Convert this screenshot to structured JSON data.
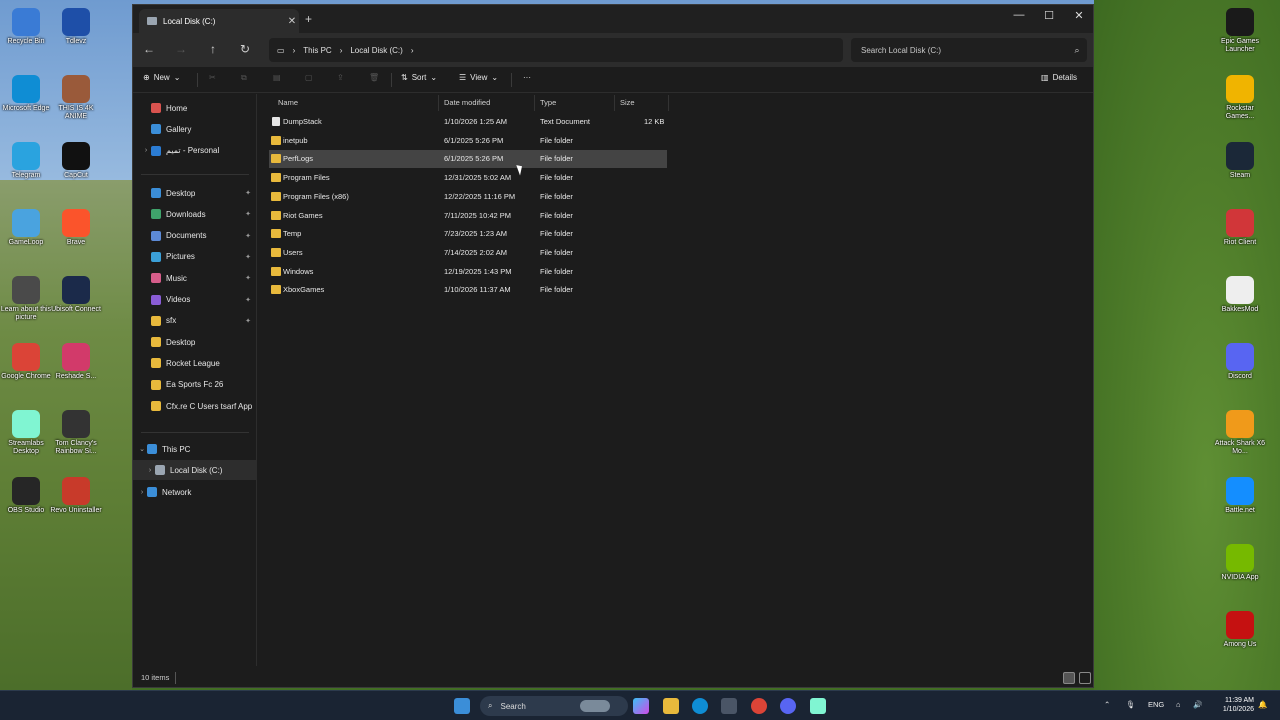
{
  "desktop_left": [
    {
      "label": "Recycle Bin",
      "icon": "recycle-bin-icon",
      "color": "#3a7bd5"
    },
    {
      "label": "Tdlevz",
      "icon": "app-icon",
      "color": "#1e4fa8"
    },
    {
      "label": "Microsoft Edge",
      "icon": "edge-icon",
      "color": "#0f8dd4"
    },
    {
      "label": "THIS IS 4K ANIME",
      "icon": "anime-icon",
      "color": "#9a5a3a"
    },
    {
      "label": "Telegram",
      "icon": "telegram-icon",
      "color": "#2aa3df"
    },
    {
      "label": "CapCut",
      "icon": "capcut-icon",
      "color": "#111111"
    },
    {
      "label": "GameLoop",
      "icon": "gameloop-icon",
      "color": "#4aa3df"
    },
    {
      "label": "Brave",
      "icon": "brave-icon",
      "color": "#fb542b"
    },
    {
      "label": "Learn about this picture",
      "icon": "camera-icon",
      "color": "#4a4a4a"
    },
    {
      "label": "Ubisoft Connect",
      "icon": "ubisoft-icon",
      "color": "#1b2a4a"
    },
    {
      "label": "Google Chrome",
      "icon": "chrome-icon",
      "color": "#db4437"
    },
    {
      "label": "Reshade S...",
      "icon": "reshade-icon",
      "color": "#d23a6a"
    },
    {
      "label": "Streamlabs Desktop",
      "icon": "streamlabs-icon",
      "color": "#80f5d2"
    },
    {
      "label": "Tom Clancy's Rainbow Si...",
      "icon": "rainbow-six-icon",
      "color": "#333333"
    },
    {
      "label": "OBS Studio",
      "icon": "obs-icon",
      "color": "#262626"
    },
    {
      "label": "Revo Uninstaller",
      "icon": "revo-icon",
      "color": "#c83a2a"
    }
  ],
  "desktop_right": [
    {
      "label": "Epic Games Launcher",
      "icon": "epic-icon",
      "color": "#1a1a1a"
    },
    {
      "label": "Rockstar Games...",
      "icon": "rockstar-icon",
      "color": "#f0b400"
    },
    {
      "label": "Steam",
      "icon": "steam-icon",
      "color": "#1b2838"
    },
    {
      "label": "Riot Client",
      "icon": "riot-icon",
      "color": "#d13639"
    },
    {
      "label": "BakkesMod",
      "icon": "bakkesmod-icon",
      "color": "#eeeeee"
    },
    {
      "label": "Discord",
      "icon": "discord-icon",
      "color": "#5865f2"
    },
    {
      "label": "Attack Shark X6 Mo...",
      "icon": "shark-icon",
      "color": "#f09a1a"
    },
    {
      "label": "Battle.net",
      "icon": "battlenet-icon",
      "color": "#148eff"
    },
    {
      "label": "NVIDIA App",
      "icon": "nvidia-icon",
      "color": "#76b900"
    },
    {
      "label": "Among Us",
      "icon": "among-us-icon",
      "color": "#c51111"
    }
  ],
  "window": {
    "tab_title": "Local Disk (C:)",
    "breadcrumb": [
      "This PC",
      "Local Disk (C:)"
    ],
    "search_placeholder": "Search Local Disk (C:)",
    "new_label": "New",
    "sort_label": "Sort",
    "view_label": "View",
    "more_label": "···",
    "details_label": "Details"
  },
  "sidebar": {
    "top": [
      {
        "label": "Home",
        "color": "#d9534f"
      },
      {
        "label": "Gallery",
        "color": "#3b8ed8"
      },
      {
        "label": "تميم - Personal",
        "color": "#2b7cd3"
      }
    ],
    "quick": [
      {
        "label": "Desktop",
        "color": "#3b8ed8",
        "pinned": true
      },
      {
        "label": "Downloads",
        "color": "#3fa36b",
        "pinned": true
      },
      {
        "label": "Documents",
        "color": "#5d8ad6",
        "pinned": true
      },
      {
        "label": "Pictures",
        "color": "#3ba0d8",
        "pinned": true
      },
      {
        "label": "Music",
        "color": "#d65d8a",
        "pinned": true
      },
      {
        "label": "Videos",
        "color": "#8a5dd6",
        "pinned": true
      },
      {
        "label": "sfx",
        "color": "#e8b93c",
        "pinned": true
      },
      {
        "label": "Desktop",
        "color": "#e8b93c",
        "pinned": false
      },
      {
        "label": "Rocket League",
        "color": "#e8b93c",
        "pinned": false
      },
      {
        "label": "Ea Sports Fc 26",
        "color": "#e8b93c",
        "pinned": false
      },
      {
        "label": "Cfx.re  C  Users tsarf App",
        "color": "#e8b93c",
        "pinned": false
      }
    ],
    "tree": [
      {
        "label": "This PC",
        "color": "#3b8ed8"
      },
      {
        "label": "Local Disk (C:)",
        "color": "#9aa5b1"
      },
      {
        "label": "Network",
        "color": "#3b8ed8"
      }
    ]
  },
  "columns": {
    "name": "Name",
    "date": "Date modified",
    "type": "Type",
    "size": "Size"
  },
  "files": [
    {
      "name": "DumpStack",
      "date": "1/10/2026 1:25 AM",
      "type": "Text Document",
      "size": "12 KB",
      "doc": true
    },
    {
      "name": "inetpub",
      "date": "6/1/2025 5:26 PM",
      "type": "File folder",
      "size": ""
    },
    {
      "name": "PerfLogs",
      "date": "6/1/2025 5:26 PM",
      "type": "File folder",
      "size": "",
      "selected": true
    },
    {
      "name": "Program Files",
      "date": "12/31/2025 5:02 AM",
      "type": "File folder",
      "size": ""
    },
    {
      "name": "Program Files (x86)",
      "date": "12/22/2025 11:16 PM",
      "type": "File folder",
      "size": ""
    },
    {
      "name": "Riot Games",
      "date": "7/11/2025 10:42 PM",
      "type": "File folder",
      "size": ""
    },
    {
      "name": "Temp",
      "date": "7/23/2025 1:23 AM",
      "type": "File folder",
      "size": ""
    },
    {
      "name": "Users",
      "date": "7/14/2025 2:02 AM",
      "type": "File folder",
      "size": ""
    },
    {
      "name": "Windows",
      "date": "12/19/2025 1:43 PM",
      "type": "File folder",
      "size": ""
    },
    {
      "name": "XboxGames",
      "date": "1/10/2026 11:37 AM",
      "type": "File folder",
      "size": ""
    }
  ],
  "status": {
    "count": "10 items"
  },
  "taskbar": {
    "search_label": "Search",
    "lang": "ENG",
    "time": "11:39 AM",
    "date": "1/10/2026"
  }
}
